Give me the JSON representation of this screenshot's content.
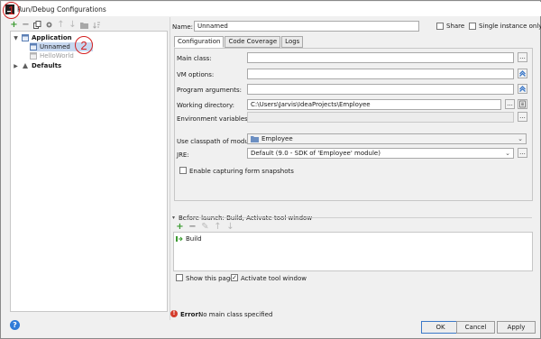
{
  "window": {
    "title": "Run/Debug Configurations"
  },
  "annotations": {
    "one": "1",
    "two": "2"
  },
  "left_toolbar": {
    "icons": [
      "add-icon",
      "remove-icon",
      "copy-icon",
      "settings-icon",
      "move-up-icon",
      "move-down-icon",
      "folder-icon",
      "sort-icon"
    ]
  },
  "tree": {
    "application_label": "Application",
    "unnamed_label": "Unnamed",
    "helloworld_label": "HelloWorld",
    "defaults_label": "Defaults"
  },
  "header": {
    "name_label": "Name:",
    "name_value": "Unnamed",
    "share_label": "Share",
    "share_checked": false,
    "single_instance_label": "Single instance only",
    "single_instance_checked": false
  },
  "tabs": [
    "Configuration",
    "Code Coverage",
    "Logs"
  ],
  "config": {
    "main_class_label": "Main class:",
    "main_class_value": "",
    "vm_options_label": "VM options:",
    "vm_options_value": "",
    "program_args_label": "Program arguments:",
    "program_args_value": "",
    "working_dir_label": "Working directory:",
    "working_dir_value": "C:\\Users\\Jarvis\\IdeaProjects\\Employee",
    "env_vars_label": "Environment variables:",
    "env_vars_value": "",
    "classpath_label": "Use classpath of module:",
    "classpath_value": "Employee",
    "jre_label": "JRE:",
    "jre_value": "Default (9.0 - SDK of 'Employee' module)",
    "enable_snapshots_label": "Enable capturing form snapshots",
    "enable_snapshots_checked": false,
    "ellipsis": "..."
  },
  "before_launch": {
    "header": "Before launch: Build, Activate tool window",
    "items": [
      "Build"
    ]
  },
  "footer_options": {
    "show_page_label": "Show this page",
    "show_page_checked": false,
    "activate_label": "Activate tool window",
    "activate_checked": true
  },
  "status": {
    "error_label": "Error:",
    "error_text": "No main class specified"
  },
  "buttons": {
    "ok": "OK",
    "cancel": "Cancel",
    "apply": "Apply"
  },
  "colors": {
    "accent": "#3b78c8",
    "add_green": "#3a9a2f",
    "error_red": "#d43c2c",
    "annotation_red": "#d42020",
    "selection": "#c7d8f0"
  }
}
